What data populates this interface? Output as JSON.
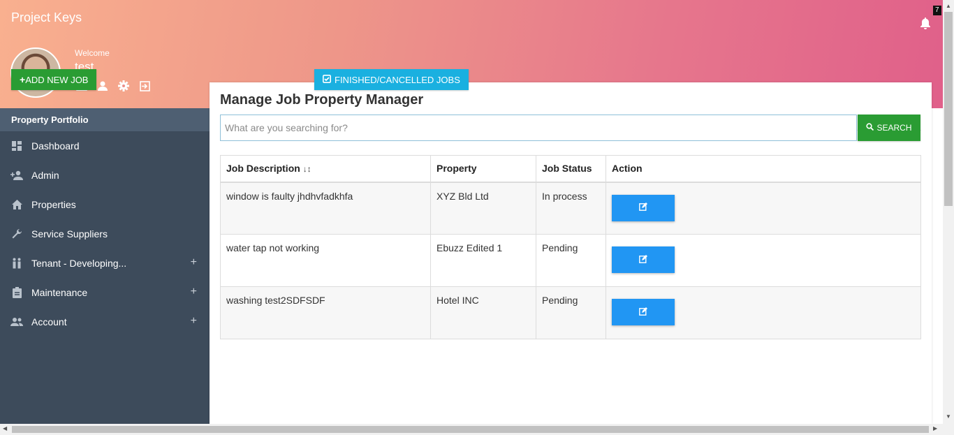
{
  "app": {
    "title": "Project Keys",
    "notification_count": "7"
  },
  "user": {
    "welcome": "Welcome",
    "name": "test"
  },
  "sidebar": {
    "header": "Property Portfolio",
    "items": [
      {
        "label": "Dashboard",
        "icon": "dashboard-icon",
        "expandable": false
      },
      {
        "label": "Admin",
        "icon": "person-add-icon",
        "expandable": false
      },
      {
        "label": "Properties",
        "icon": "home-icon",
        "expandable": false
      },
      {
        "label": "Service Suppliers",
        "icon": "wrench-icon",
        "expandable": false
      },
      {
        "label": "Tenant - Developing...",
        "icon": "people-icon",
        "expandable": true
      },
      {
        "label": "Maintenance",
        "icon": "clipboard-icon",
        "expandable": true
      },
      {
        "label": "Account",
        "icon": "group-icon",
        "expandable": true
      }
    ],
    "expand_symbol": "+"
  },
  "main": {
    "title": "Manage Job Property Manager",
    "add_job_label": "ADD NEW JOB",
    "finished_label": "FINISHED/CANCELLED JOBS",
    "search": {
      "placeholder": "What are you searching for?",
      "button_label": "SEARCH"
    },
    "table": {
      "columns": [
        "Job Description",
        "Property",
        "Job Status",
        "Action"
      ],
      "rows": [
        {
          "description": "window is faulty jhdhvfadkhfa",
          "property": "XYZ Bld Ltd",
          "status": "In process"
        },
        {
          "description": "water tap not working",
          "property": "Ebuzz Edited 1",
          "status": "Pending"
        },
        {
          "description": "washing test2SDFSDF",
          "property": "Hotel INC",
          "status": "Pending"
        }
      ]
    }
  },
  "colors": {
    "add_button": "#2a9c33",
    "finished_button": "#1ab0e0",
    "edit_button": "#2196f3",
    "sidebar": "#3d4b5b"
  }
}
